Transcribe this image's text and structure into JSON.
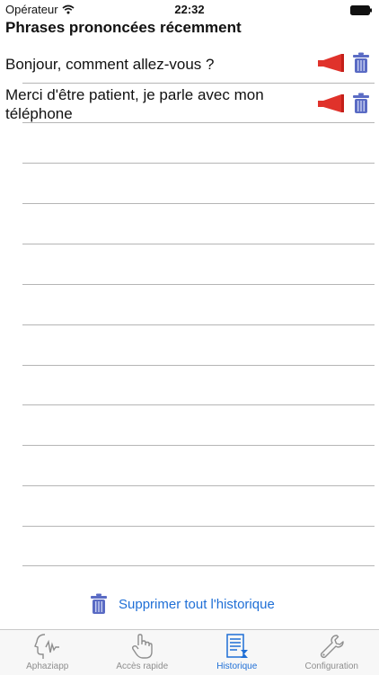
{
  "status_bar": {
    "carrier": "Opérateur",
    "time": "22:32"
  },
  "page": {
    "title": "Phrases prononcées récemment"
  },
  "history": [
    {
      "text": "Bonjour, comment allez-vous ?"
    },
    {
      "text": "Merci d'être patient, je parle avec mon téléphone"
    }
  ],
  "actions": {
    "clear_all_label": "Supprimer tout l'historique"
  },
  "tabs": [
    {
      "label": "Aphaziapp",
      "icon": "face-speech-icon",
      "active": false
    },
    {
      "label": "Accès rapide",
      "icon": "hand-pointer-icon",
      "active": false
    },
    {
      "label": "Historique",
      "icon": "history-list-icon",
      "active": true
    },
    {
      "label": "Configuration",
      "icon": "wrench-icon",
      "active": false
    }
  ],
  "colors": {
    "accent": "#1f6fd6",
    "speaker": "#e0322b",
    "trash": "#5a6bc4"
  }
}
